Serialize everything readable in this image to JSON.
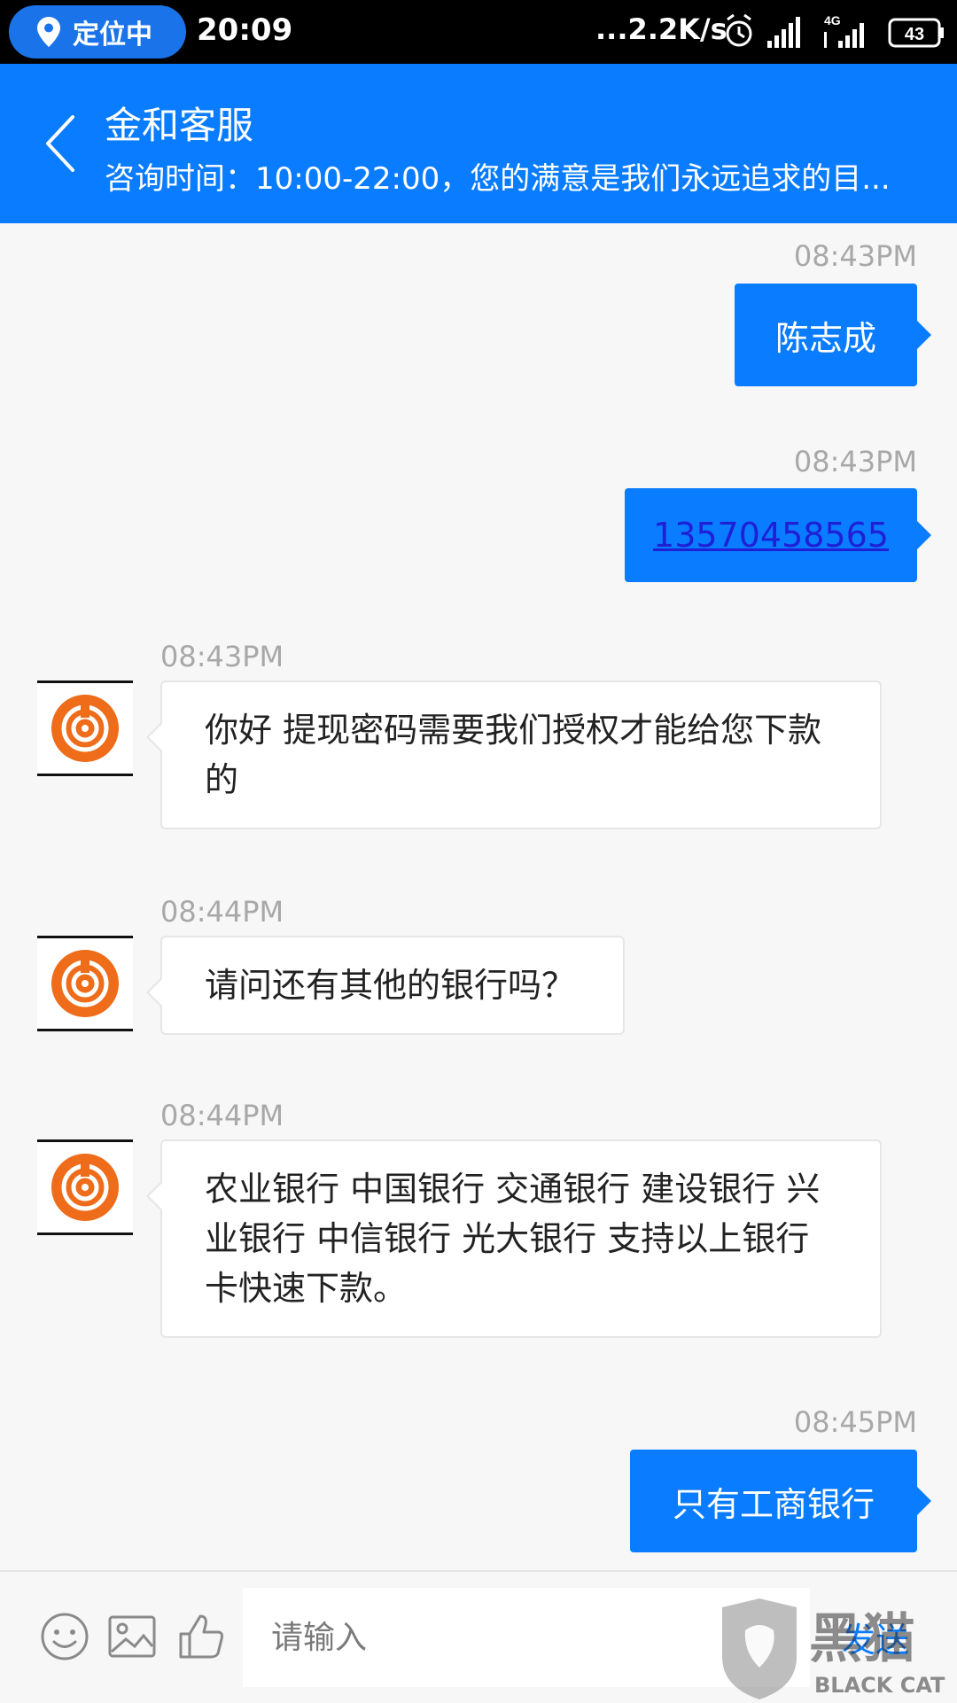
{
  "status_bar": {
    "location_label": "定位中",
    "time": "20:09",
    "network_speed": "...2.2K/s",
    "network_type": "4G",
    "battery": "43",
    "icons": [
      "location-pin-icon",
      "alarm-icon",
      "signal-icon",
      "battery-icon"
    ]
  },
  "header": {
    "title": "金和客服",
    "subtitle": "咨询时间：10:00-22:00，您的满意是我们永远追求的目...",
    "back_icon": "chevron-left-icon",
    "color": "#0a7cff"
  },
  "messages": [
    {
      "direction": "out",
      "time": "08:43PM",
      "text": "陈志成"
    },
    {
      "direction": "out",
      "time": "08:43PM",
      "text": "13570458565",
      "is_link": true
    },
    {
      "direction": "in",
      "time": "08:43PM",
      "text": "你好 提现密码需要我们授权才能给您下款的"
    },
    {
      "direction": "in",
      "time": "08:44PM",
      "text": "请问还有其他的银行吗？"
    },
    {
      "direction": "in",
      "time": "08:44PM",
      "text": "农业银行 中国银行 交通银行 建设银行 兴业银行 中信银行 光大银行 支持以上银行卡快速下款。"
    },
    {
      "direction": "out",
      "time": "08:45PM",
      "text": "只有工商银行"
    }
  ],
  "input_bar": {
    "placeholder": "请输入",
    "send_label": "发送",
    "icons": [
      "emoji-icon",
      "image-icon",
      "thumbs-up-icon"
    ]
  },
  "watermark": {
    "text": "黑猫",
    "subtext": "BLACK CAT"
  },
  "colors": {
    "accent": "#0a7cff",
    "avatar_orange": "#ef6c1a",
    "bubble_in_bg": "#ffffff",
    "timestamp": "#a8a8a8"
  }
}
